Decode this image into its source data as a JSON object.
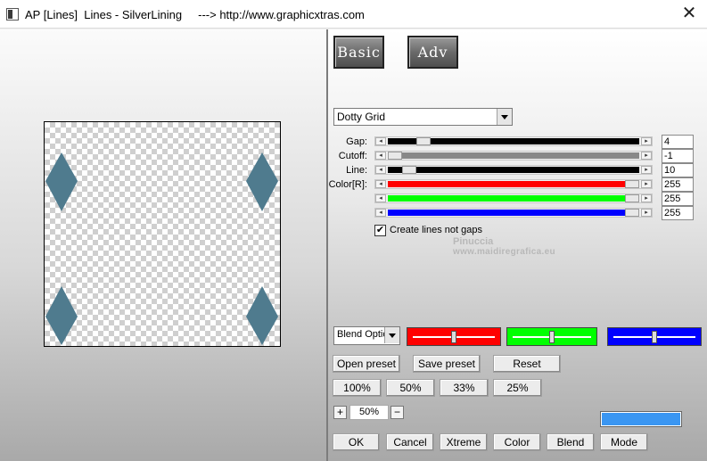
{
  "window": {
    "title": "AP [Lines]  Lines - SilverLining     ---> http://www.graphicxtras.com",
    "close_glyph": "✕"
  },
  "modes": {
    "basic_label": "Basic",
    "adv_label": "Adv"
  },
  "effect": {
    "selected": "Dotty Grid"
  },
  "sliders": [
    {
      "label": "Gap:",
      "value": "4",
      "fill_color": "#000000",
      "level": 0.12
    },
    {
      "label": "Cutoff:",
      "value": "-1",
      "fill_color": "#888888",
      "level": 0.0
    },
    {
      "label": "Line:",
      "value": "10",
      "fill_color": "#000000",
      "level": 0.06
    },
    {
      "label": "Color[R]:",
      "value": "255",
      "fill_color": "#ff0000",
      "level": 1.0
    },
    {
      "label": "",
      "value": "255",
      "fill_color": "#00ff00",
      "level": 1.0
    },
    {
      "label": "",
      "value": "255",
      "fill_color": "#0000ff",
      "level": 1.0
    }
  ],
  "option": {
    "check_mark": "✔",
    "label": "Create lines not gaps",
    "checked": true
  },
  "watermark": {
    "name": "Pinuccia",
    "site": "www.maidiregrafica.eu"
  },
  "blend": {
    "dropdown_value": "Blend Optio",
    "swatches": [
      {
        "color": "#ff0000",
        "level": 0.5
      },
      {
        "color": "#00ff00",
        "level": 0.5
      },
      {
        "color": "#0000ff",
        "level": 0.5
      }
    ]
  },
  "preset_buttons": {
    "open": "Open preset",
    "save": "Save preset",
    "reset": "Reset"
  },
  "zoom_buttons": [
    "100%",
    "50%",
    "33%",
    "25%"
  ],
  "zoom": {
    "plus": "+",
    "value": "50%",
    "minus": "−"
  },
  "preview_swatch_color": "#3a96f2",
  "bottom_buttons": {
    "ok": "OK",
    "cancel": "Cancel",
    "xtreme": "Xtreme",
    "color": "Color",
    "blend": "Blend",
    "mode": "Mode"
  },
  "preview": {
    "diamond_color": "#4f7b8e"
  }
}
